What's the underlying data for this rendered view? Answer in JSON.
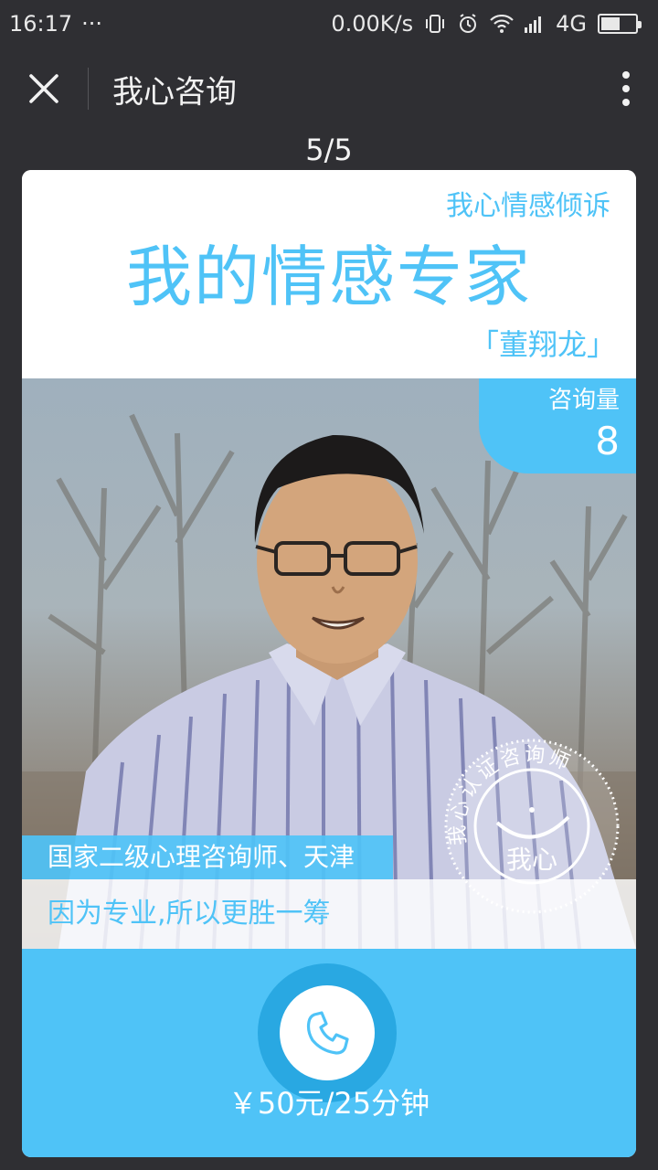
{
  "status_bar": {
    "time": "16:17",
    "dots": "···",
    "network_speed": "0.00K/s",
    "network_type": "4G",
    "battery_level": 0.55
  },
  "title_bar": {
    "title": "我心咨询"
  },
  "pager": {
    "label": "5/5"
  },
  "card": {
    "subtitle": "我心情感倾诉",
    "main_title": "我的情感专家",
    "expert_name": "「董翔龙」",
    "consult_label": "咨询量",
    "consult_count": "8",
    "qualification": "国家二级心理咨询师、天津",
    "slogan": "因为专业,所以更胜一筹",
    "seal_text": "我心认证咨询师",
    "seal_center": "我心",
    "price": "￥50元/25分钟"
  },
  "colors": {
    "accent": "#4fc3f7",
    "accent_dark": "#29a8e2",
    "background": "#2f2f33"
  }
}
